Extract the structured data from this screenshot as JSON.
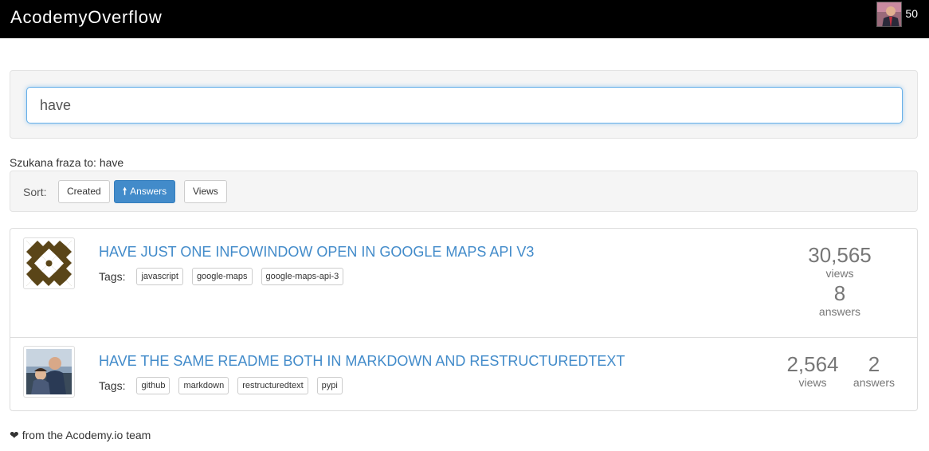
{
  "header": {
    "brand": "AcodemyOverflow",
    "reputation": "50"
  },
  "search": {
    "value": "have"
  },
  "phrase": {
    "label": "Szukana fraza to: have"
  },
  "sort": {
    "label": "Sort:",
    "buttons": [
      "Created",
      "Answers",
      "Views"
    ],
    "active": "Answers"
  },
  "results": [
    {
      "title": "HAVE JUST ONE INFOWINDOW OPEN IN GOOGLE MAPS API V3",
      "tags_label": "Tags:",
      "tags": [
        "javascript",
        "google-maps",
        "google-maps-api-3"
      ],
      "views": "30,565",
      "views_label": "views",
      "answers": "8",
      "answers_label": "answers"
    },
    {
      "title": "HAVE THE SAME README BOTH IN MARKDOWN AND RESTRUCTUREDTEXT",
      "tags_label": "Tags:",
      "tags": [
        "github",
        "markdown",
        "restructuredtext",
        "pypi"
      ],
      "views": "2,564",
      "views_label": "views",
      "answers": "2",
      "answers_label": "answers"
    }
  ],
  "footer": {
    "text": "from the Acodemy.io team"
  },
  "colors": {
    "accent": "#428bca",
    "topbar": "#000000",
    "well": "#f5f5f5"
  }
}
